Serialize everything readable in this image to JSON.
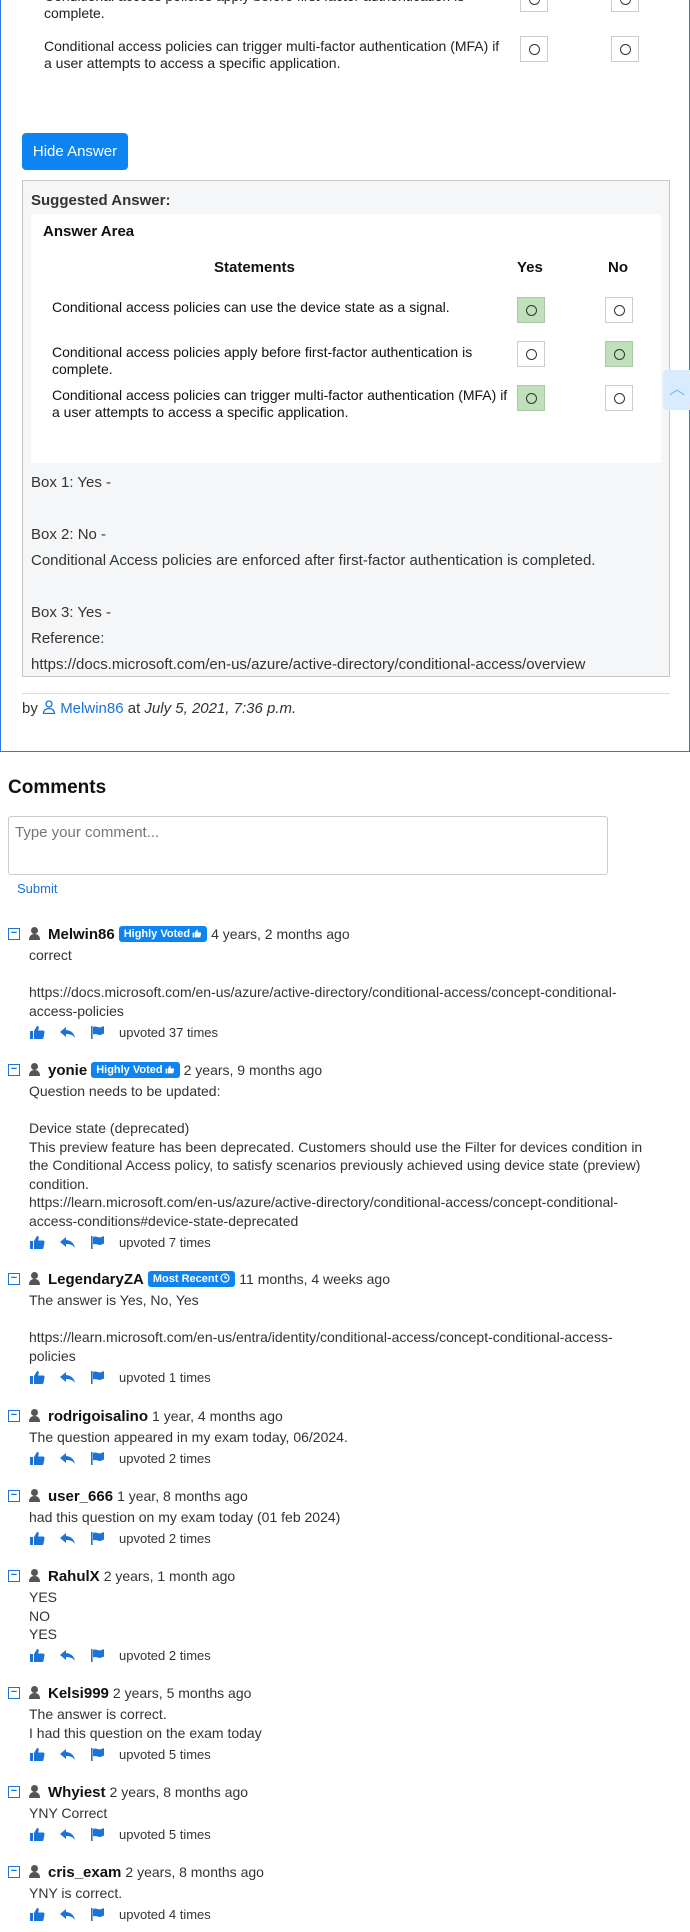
{
  "question": {
    "rows": [
      {
        "text": "Conditional access policies apply before first-factor authentication is complete."
      },
      {
        "text": "Conditional access policies can trigger multi-factor authentication (MFA) if a user attempts to access a specific application."
      }
    ]
  },
  "hide_answer_label": "Hide Answer",
  "suggested": {
    "title": "Suggested Answer:",
    "answer_area_title": "Answer Area",
    "col_statements": "Statements",
    "col_yes": "Yes",
    "col_no": "No",
    "rows": [
      {
        "text": "Conditional access policies can use the device state as a signal.",
        "answer": "yes"
      },
      {
        "text": "Conditional access policies apply before first-factor authentication is complete.",
        "answer": "no"
      },
      {
        "text": "Conditional access policies can trigger multi-factor authentication (MFA) if a user attempts to access a specific application.",
        "answer": "yes"
      }
    ],
    "explanation": [
      "Box 1: Yes -",
      "Box 2: No -",
      "Conditional Access policies are enforced after first-factor authentication is completed.",
      "Box 3: Yes -",
      "Reference:",
      "https://docs.microsoft.com/en-us/azure/active-directory/conditional-access/overview"
    ]
  },
  "byline": {
    "by": "by",
    "user": "Melwin86",
    "at": "at",
    "date": "July 5, 2021, 7:36 p.m."
  },
  "comments_title": "Comments",
  "comment_placeholder": "Type your comment...",
  "submit_label": "Submit",
  "comments": [
    {
      "user": "Melwin86",
      "badge": "Highly Voted",
      "ago": "4 years, 2 months ago",
      "lines": [
        "correct",
        "",
        "https://docs.microsoft.com/en-us/azure/active-directory/conditional-access/concept-conditional-",
        "access-policies"
      ],
      "votes": "upvoted 37 times"
    },
    {
      "user": "yonie",
      "badge": "Highly Voted",
      "ago": "2 years, 9 months ago",
      "lines": [
        "Question needs to be updated:",
        "",
        "Device state (deprecated)",
        "This preview feature has been deprecated. Customers should use the Filter for devices condition in",
        "the Conditional Access policy, to satisfy scenarios previously achieved using device state (preview)",
        "condition.",
        "https://learn.microsoft.com/en-us/azure/active-directory/conditional-access/concept-conditional-",
        "access-conditions#device-state-deprecated"
      ],
      "votes": "upvoted 7 times"
    },
    {
      "user": "LegendaryZA",
      "badge": "Most Recent",
      "ago": "11 months, 4 weeks ago",
      "lines": [
        "The answer is Yes, No, Yes",
        "",
        "https://learn.microsoft.com/en-us/entra/identity/conditional-access/concept-conditional-access-",
        "policies"
      ],
      "votes": "upvoted 1 times"
    },
    {
      "user": "rodrigoisalino",
      "badge": "",
      "ago": "1 year, 4 months ago",
      "lines": [
        "The question appeared in my exam today, 06/2024."
      ],
      "votes": "upvoted 2 times"
    },
    {
      "user": "user_666",
      "badge": "",
      "ago": "1 year, 8 months ago",
      "lines": [
        "had this question on my exam today (01 feb 2024)"
      ],
      "votes": "upvoted 2 times"
    },
    {
      "user": "RahulX",
      "badge": "",
      "ago": "2 years, 1 month ago",
      "lines": [
        "YES",
        "NO",
        "YES"
      ],
      "votes": "upvoted 2 times"
    },
    {
      "user": "Kelsi999",
      "badge": "",
      "ago": "2 years, 5 months ago",
      "lines": [
        "The answer is correct.",
        "I had this question on the exam today"
      ],
      "votes": "upvoted 5 times"
    },
    {
      "user": "Whyiest",
      "badge": "",
      "ago": "2 years, 8 months ago",
      "lines": [
        "YNY Correct"
      ],
      "votes": "upvoted 5 times"
    },
    {
      "user": "cris_exam",
      "badge": "",
      "ago": "2 years, 8 months ago",
      "lines": [
        "YNY is correct."
      ],
      "votes": "upvoted 4 times"
    }
  ]
}
